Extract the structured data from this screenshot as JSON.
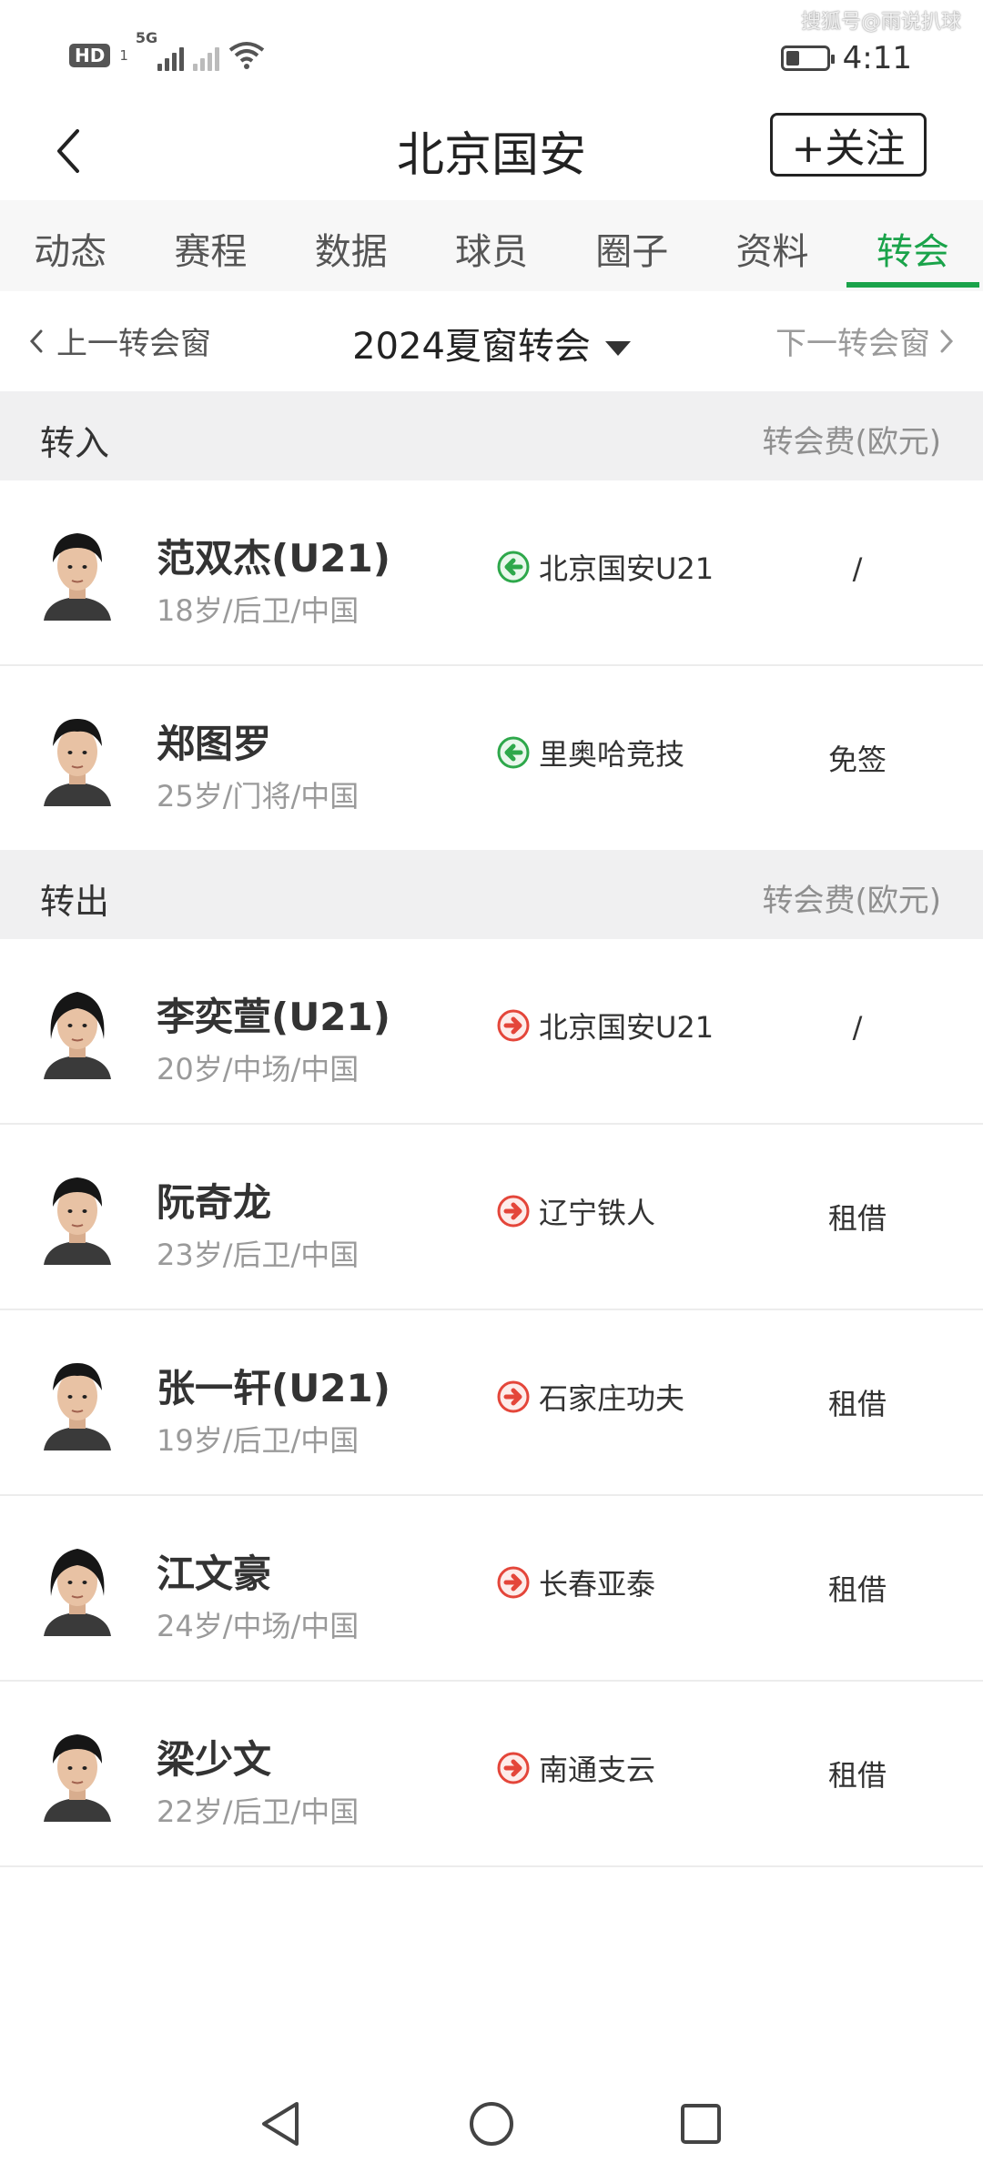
{
  "status_bar": {
    "hd": "HD",
    "hd_sub": "1",
    "net": "5G",
    "time": "4:11",
    "watermark": "搜狐号@雨说扒球"
  },
  "header": {
    "title": "北京国安",
    "follow_label": "+关注"
  },
  "tabs": [
    "动态",
    "赛程",
    "数据",
    "球员",
    "圈子",
    "资料",
    "转会"
  ],
  "active_tab": "转会",
  "window_nav": {
    "prev": "上一转会窗",
    "current": "2024夏窗转会",
    "next": "下一转会窗"
  },
  "sections": {
    "in": {
      "title": "转入",
      "fee_header": "转会费(欧元)"
    },
    "out": {
      "title": "转出",
      "fee_header": "转会费(欧元)"
    }
  },
  "transfers_in": [
    {
      "name": "范双杰(U21)",
      "meta": "18岁/后卫/中国",
      "club": "北京国安U21",
      "fee": "/",
      "direction": "in"
    },
    {
      "name": "郑图罗",
      "meta": "25岁/门将/中国",
      "club": "里奥哈竞技",
      "fee": "免签",
      "direction": "in"
    }
  ],
  "transfers_out": [
    {
      "name": "李奕萱(U21)",
      "meta": "20岁/中场/中国",
      "club": "北京国安U21",
      "fee": "/",
      "direction": "out"
    },
    {
      "name": "阮奇龙",
      "meta": "23岁/后卫/中国",
      "club": "辽宁铁人",
      "fee": "租借",
      "direction": "out"
    },
    {
      "name": "张一轩(U21)",
      "meta": "19岁/后卫/中国",
      "club": "石家庄功夫",
      "fee": "租借",
      "direction": "out"
    },
    {
      "name": "江文豪",
      "meta": "24岁/中场/中国",
      "club": "长春亚泰",
      "fee": "租借",
      "direction": "out"
    },
    {
      "name": "梁少文",
      "meta": "22岁/后卫/中国",
      "club": "南通支云",
      "fee": "租借",
      "direction": "out"
    }
  ],
  "colors": {
    "accent": "#1aa34a",
    "in_arrow": "#2ea84b",
    "out_arrow": "#e4463a"
  }
}
